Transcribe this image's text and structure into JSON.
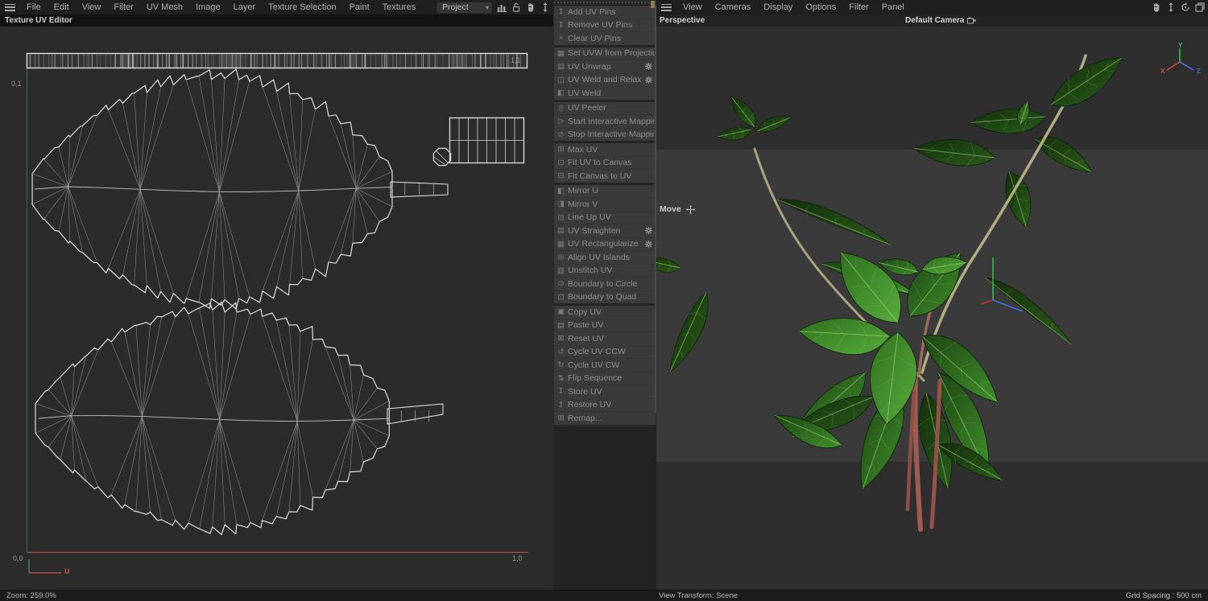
{
  "left_pane": {
    "menubar": [
      "File",
      "Edit",
      "View",
      "Filter",
      "UV Mesh",
      "Image",
      "Layer",
      "Texture Selection",
      "Paint",
      "Textures"
    ],
    "project_dropdown": "Project",
    "title": "Texture UV Editor",
    "uv": {
      "corner_tl": "0,1",
      "corner_tr": "1,1",
      "corner_bl": "0,0",
      "corner_br": "1,0",
      "u_axis_label": "U"
    },
    "status": "Zoom: 259.0%"
  },
  "palette": {
    "groups": [
      {
        "items": [
          {
            "label": "Add UV Pins",
            "icon": "pin-add-icon",
            "gear": false
          },
          {
            "label": "Remove UV Pins",
            "icon": "pin-remove-icon",
            "gear": false
          },
          {
            "label": "Clear UV Pins",
            "icon": "clear-icon",
            "gear": false
          }
        ]
      },
      {
        "items": [
          {
            "label": "Set UVW from Projection",
            "icon": "projection-icon",
            "gear": true
          },
          {
            "label": "UV Unwrap",
            "icon": "unwrap-icon",
            "gear": true
          },
          {
            "label": "UV Weld and Relax",
            "icon": "weld-relax-icon",
            "gear": true
          },
          {
            "label": "UV Weld",
            "icon": "weld-icon",
            "gear": false
          }
        ]
      },
      {
        "items": [
          {
            "label": "UV Peeler",
            "icon": "peeler-icon",
            "gear": false
          },
          {
            "label": "Start Interactive Mapping",
            "icon": "play-icon",
            "gear": false
          },
          {
            "label": "Stop Interactive Mapping",
            "icon": "stop-icon",
            "gear": false
          }
        ]
      },
      {
        "items": [
          {
            "label": "Max UV",
            "icon": "max-uv-icon",
            "gear": false
          },
          {
            "label": "Fit UV to Canvas",
            "icon": "fit-uv-icon",
            "gear": false
          },
          {
            "label": "Fit Canvas to UV",
            "icon": "fit-canvas-icon",
            "gear": false
          }
        ]
      },
      {
        "items": [
          {
            "label": "Mirror U",
            "icon": "mirror-u-icon",
            "gear": false
          },
          {
            "label": "Mirror V",
            "icon": "mirror-v-icon",
            "gear": false
          },
          {
            "label": "Line Up UV",
            "icon": "lineup-icon",
            "gear": false
          },
          {
            "label": "UV Straighten",
            "icon": "straighten-icon",
            "gear": true
          },
          {
            "label": "UV Rectangularize",
            "icon": "rectangularize-icon",
            "gear": true
          },
          {
            "label": "Align UV Islands",
            "icon": "align-icon",
            "gear": false
          },
          {
            "label": "Unstitch UV",
            "icon": "unstitch-icon",
            "gear": false
          },
          {
            "label": "Boundary to Circle",
            "icon": "boundary-circle-icon",
            "gear": false
          },
          {
            "label": "Boundary to Quad",
            "icon": "boundary-quad-icon",
            "gear": false
          }
        ]
      },
      {
        "items": [
          {
            "label": "Copy UV",
            "icon": "copy-icon",
            "gear": false
          },
          {
            "label": "Paste UV",
            "icon": "paste-icon",
            "gear": false
          },
          {
            "label": "Reset UV",
            "icon": "reset-icon",
            "gear": false
          },
          {
            "label": "Cycle UV CCW",
            "icon": "cycle-ccw-icon",
            "gear": false
          },
          {
            "label": "Cycle UV CW",
            "icon": "cycle-cw-icon",
            "gear": false
          },
          {
            "label": "Flip Sequence",
            "icon": "flip-icon",
            "gear": false
          },
          {
            "label": "Store UV",
            "icon": "store-icon",
            "gear": false
          },
          {
            "label": "Restore UV",
            "icon": "restore-icon",
            "gear": false
          },
          {
            "label": "Remap...",
            "icon": "remap-icon",
            "gear": false
          }
        ]
      }
    ]
  },
  "right_pane": {
    "menubar": [
      "View",
      "Cameras",
      "Display",
      "Options",
      "Filter",
      "Panel"
    ],
    "view_label": "Perspective",
    "camera_label": "Default Camera",
    "tool_label": "Move",
    "axis": {
      "x": "X",
      "y": "Y",
      "z": "Z"
    },
    "status_left": "View Transform: Scene",
    "status_right": "Grid Spacing : 500 cm"
  },
  "colors": {
    "axis_x": "#d94f3c",
    "axis_y": "#3bbf4e",
    "axis_z": "#3f6fe0",
    "uv_u_axis": "#b05050",
    "uv_v_axis": "#3c6b4c",
    "wireframe": "#d8d8d8",
    "leaf_dark": "#1d4513",
    "leaf_bright": "#57ad3c",
    "stem_red": "#9b5a50"
  }
}
